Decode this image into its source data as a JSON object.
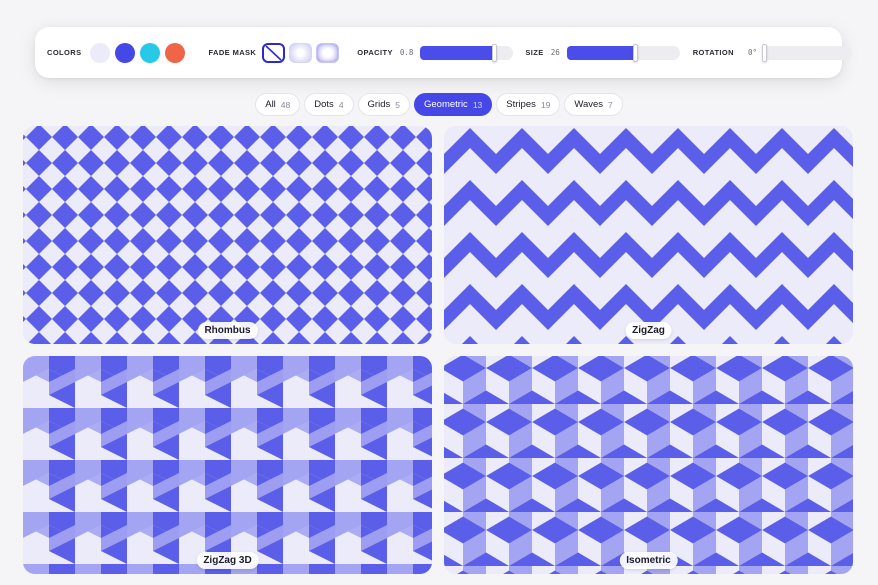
{
  "toolbar": {
    "colors_label": "COLORS",
    "colors": [
      "#ebebfa",
      "#4547e6",
      "#27c9e6",
      "#f06548"
    ],
    "fade_mask_label": "FADE MASK",
    "opacity_label": "OPACITY",
    "opacity_value": "0.8",
    "opacity_level": 0.8,
    "size_label": "SIZE",
    "size_value": "26",
    "size_level": 0.6,
    "rotation_label": "ROTATION",
    "rotation_value": "0°",
    "rotation_level": 0
  },
  "tabs": [
    {
      "label": "All",
      "count": "48"
    },
    {
      "label": "Dots",
      "count": "4"
    },
    {
      "label": "Grids",
      "count": "5"
    },
    {
      "label": "Geometric",
      "count": "13",
      "active": true
    },
    {
      "label": "Stripes",
      "count": "19"
    },
    {
      "label": "Waves",
      "count": "7"
    }
  ],
  "patterns": [
    {
      "name": "Rhombus"
    },
    {
      "name": "ZigZag"
    },
    {
      "name": "ZigZag 3D"
    },
    {
      "name": "Isometric"
    }
  ],
  "theme": {
    "accent": "#4547e6",
    "pattern_light": "#ebebfa",
    "pattern_dark": "#5b5ee8",
    "pattern_mid": "#a4a5f2"
  }
}
